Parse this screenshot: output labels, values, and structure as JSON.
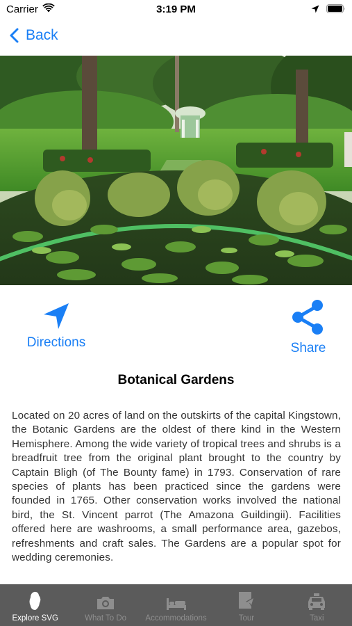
{
  "status_bar": {
    "carrier": "Carrier",
    "time": "3:19 PM"
  },
  "nav": {
    "back_label": "Back"
  },
  "hero_image": {
    "icon": "botanical-garden-photo"
  },
  "actions": {
    "directions_label": "Directions",
    "share_label": "Share"
  },
  "place": {
    "title": "Botanical Gardens",
    "description": "Located on 20 acres of land on the outskirts of the capital Kingstown, the Botanic Gardens are the oldest of there kind in the Western Hemisphere. Among the wide variety of tropical trees and shrubs is a breadfruit tree from the original plant brought to the country by Captain Bligh (of The Bounty fame) in 1793. Conservation of rare species of plants has been practiced since the gardens were founded in 1765. Other conservation works involved the national bird, the St. Vincent parrot (The Amazona Guildingii). Facilities offered here are washrooms, a small performance area, gazebos, refreshments and craft sales. The Gardens are a popular spot for wedding ceremonies."
  },
  "tabs": [
    {
      "label": "Explore SVG",
      "icon": "island-icon",
      "active": true
    },
    {
      "label": "What To Do",
      "icon": "camera-icon",
      "active": false
    },
    {
      "label": "Accommodations",
      "icon": "bed-icon",
      "active": false
    },
    {
      "label": "Tour",
      "icon": "tour-icon",
      "active": false
    },
    {
      "label": "Taxi",
      "icon": "taxi-icon",
      "active": false
    }
  ],
  "colors": {
    "accent": "#1a7ff5",
    "tab_bar": "#5b5b5b",
    "tab_inactive": "#8e8e8e",
    "tab_active": "#ffffff"
  }
}
